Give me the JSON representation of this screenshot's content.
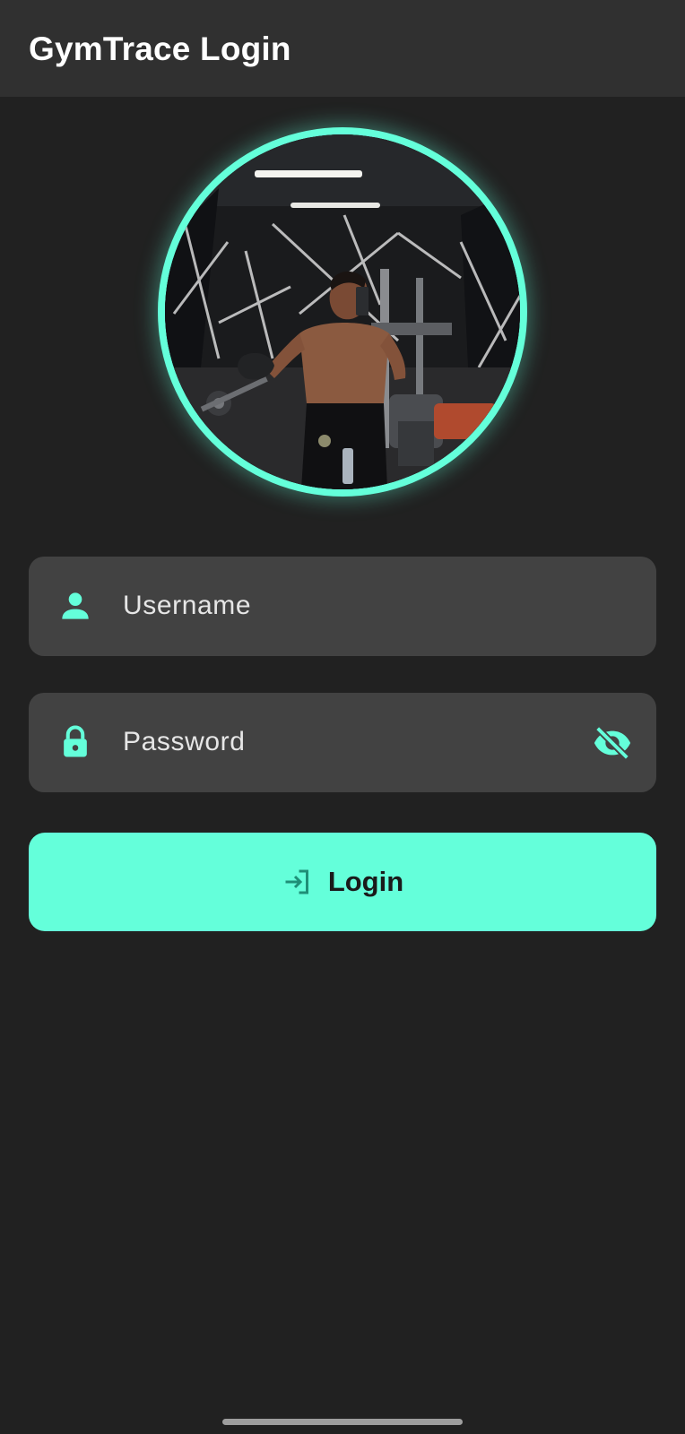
{
  "appbar": {
    "title": "GymTrace Login"
  },
  "avatar": {
    "icon": "profile-photo",
    "ring_color": "#64ffda"
  },
  "form": {
    "username": {
      "placeholder": "Username",
      "icon": "person-icon"
    },
    "password": {
      "placeholder": "Password",
      "icon": "lock-icon",
      "toggle_icon": "visibility-off-icon"
    }
  },
  "login_button": {
    "label": "Login",
    "icon": "login-icon",
    "color": "#64ffda"
  },
  "colors": {
    "background": "#212121",
    "appbar": "#303030",
    "field": "#424242",
    "accent": "#64ffda"
  }
}
